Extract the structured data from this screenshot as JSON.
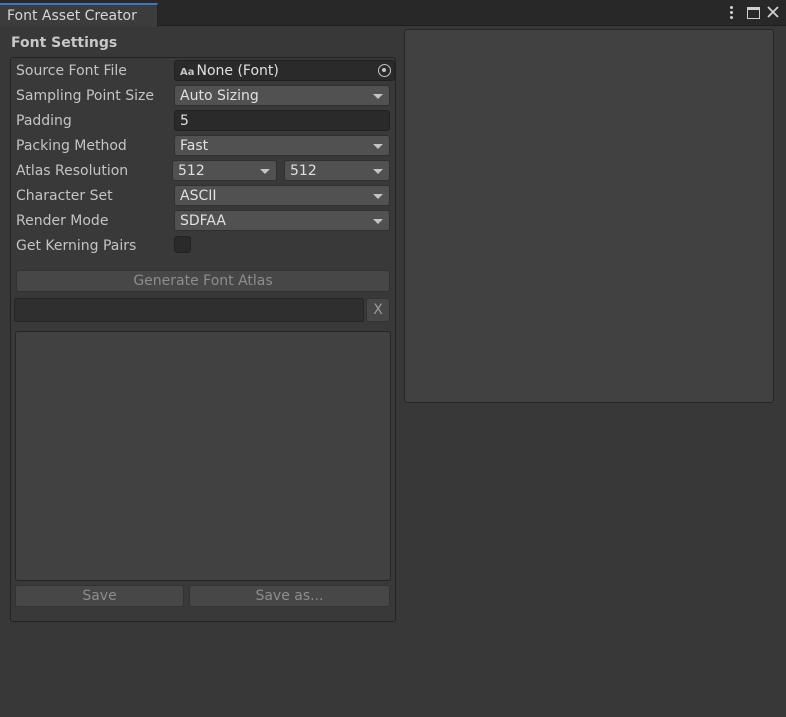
{
  "window": {
    "tab_title": "Font Asset Creator"
  },
  "settings": {
    "title": "Font Settings",
    "source_font_file": {
      "label": "Source Font File",
      "value": "None (Font)"
    },
    "sampling_point_size": {
      "label": "Sampling Point Size",
      "value": "Auto Sizing"
    },
    "padding": {
      "label": "Padding",
      "value": "5"
    },
    "packing_method": {
      "label": "Packing Method",
      "value": "Fast"
    },
    "atlas_resolution": {
      "label": "Atlas Resolution",
      "width": "512",
      "height": "512"
    },
    "character_set": {
      "label": "Character Set",
      "value": "ASCII"
    },
    "render_mode": {
      "label": "Render Mode",
      "value": "SDFAA"
    },
    "get_kerning_pairs": {
      "label": "Get Kerning Pairs",
      "checked": false
    }
  },
  "actions": {
    "generate_label": "Generate Font Atlas",
    "clear_label": "X",
    "save_label": "Save",
    "save_as_label": "Save as..."
  },
  "icons": {
    "font_icon_glyph": "Aa"
  },
  "colors": {
    "tab_accent": "#3a79bb",
    "background": "#383838",
    "field": "#515151"
  }
}
